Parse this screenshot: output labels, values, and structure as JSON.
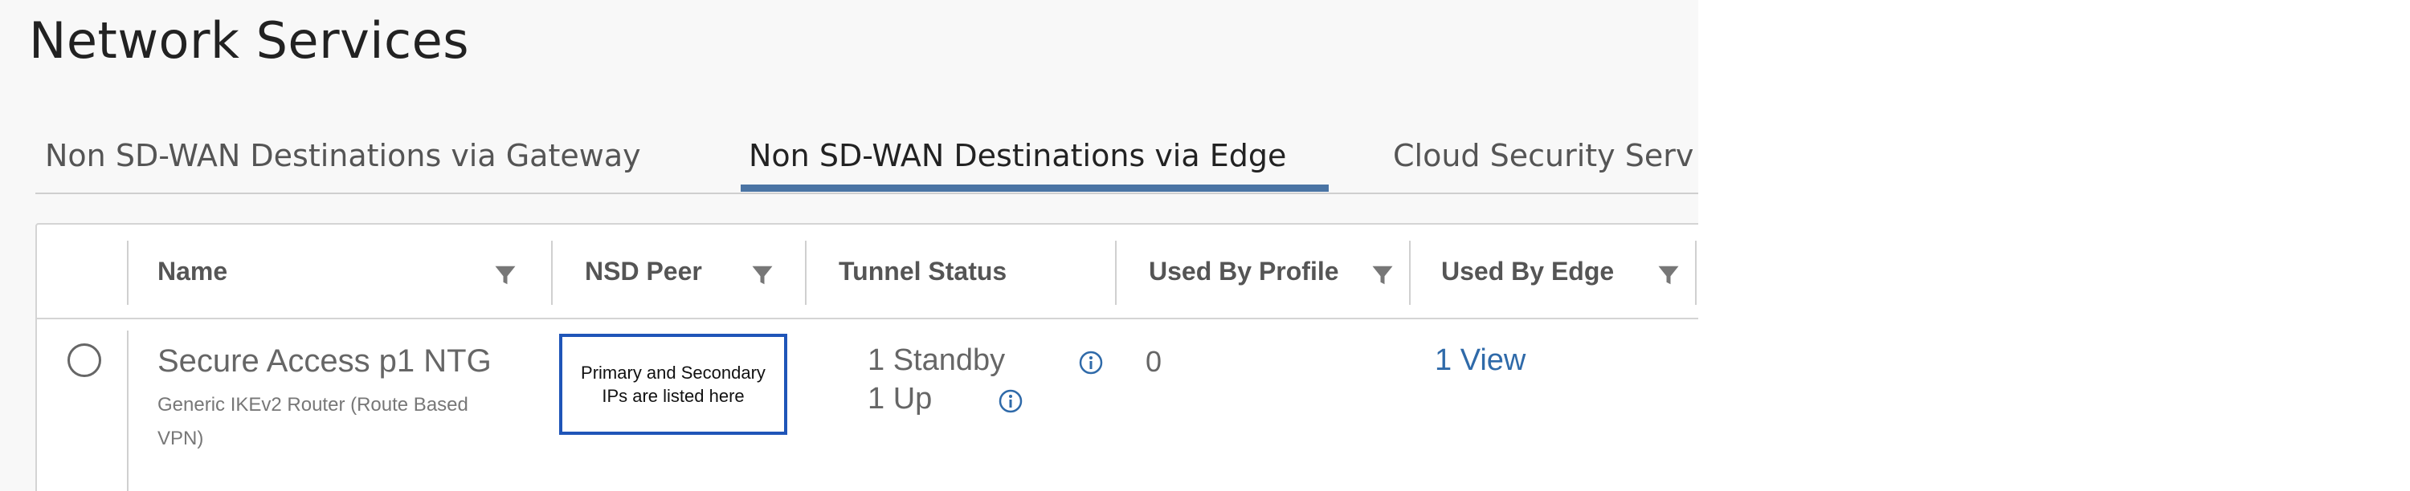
{
  "page": {
    "title": "Network Services"
  },
  "tabs": [
    {
      "label": "Non SD-WAN Destinations via Gateway",
      "active": false
    },
    {
      "label": "Non SD-WAN Destinations via Edge",
      "active": true
    },
    {
      "label": "Cloud Security Serv",
      "active": false
    }
  ],
  "colors": {
    "active_tab_underline": "#4a74a4",
    "link": "#2f6aa9",
    "annotation_border": "#1f55b8"
  },
  "table": {
    "columns": [
      {
        "label": "Name",
        "filter_icon": "filter-icon"
      },
      {
        "label": "NSD Peer",
        "filter_icon": "filter-icon"
      },
      {
        "label": "Tunnel Status"
      },
      {
        "label": "Used By Profile",
        "filter_icon": "filter-icon"
      },
      {
        "label": "Used By Edge",
        "filter_icon": "filter-icon"
      }
    ],
    "rows": [
      {
        "name": "Secure Access p1 NTG",
        "subtitle": "Generic IKEv2 Router (Route Based VPN)",
        "nsd_peer_note": "Primary and Secondary IPs are listed here",
        "tunnel_status": [
          "1 Standby",
          "1 Up"
        ],
        "used_by_profile": "0",
        "used_by_edge": "1 View"
      }
    ]
  }
}
